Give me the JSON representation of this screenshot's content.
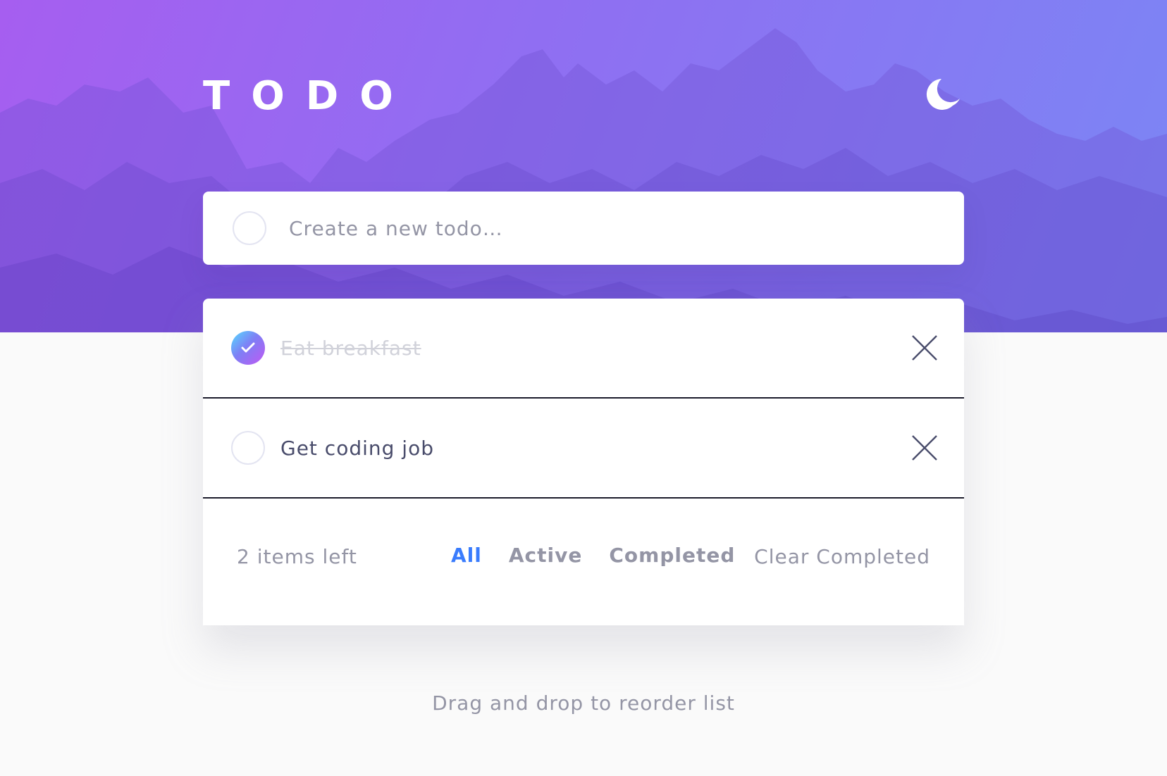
{
  "header": {
    "title": "TODO",
    "theme_icon": "moon-icon"
  },
  "new_todo": {
    "placeholder": "Create a new todo…"
  },
  "todos": [
    {
      "text": "Eat breakfast",
      "completed": true
    },
    {
      "text": "Get coding job",
      "completed": false
    }
  ],
  "footer": {
    "items_left": "2 items left",
    "filters": [
      "All",
      "Active",
      "Completed"
    ],
    "active_filter": "All",
    "clear_label": "Clear Completed"
  },
  "hint": "Drag and drop to reorder list",
  "colors": {
    "accent": "#3a7cfd",
    "gradient_start": "#55ddff",
    "gradient_end": "#c058f3",
    "muted_text": "#9495a5",
    "main_text": "#494c6b"
  },
  "icons": {
    "check": "check-icon",
    "delete": "close-icon",
    "theme": "moon-icon"
  }
}
